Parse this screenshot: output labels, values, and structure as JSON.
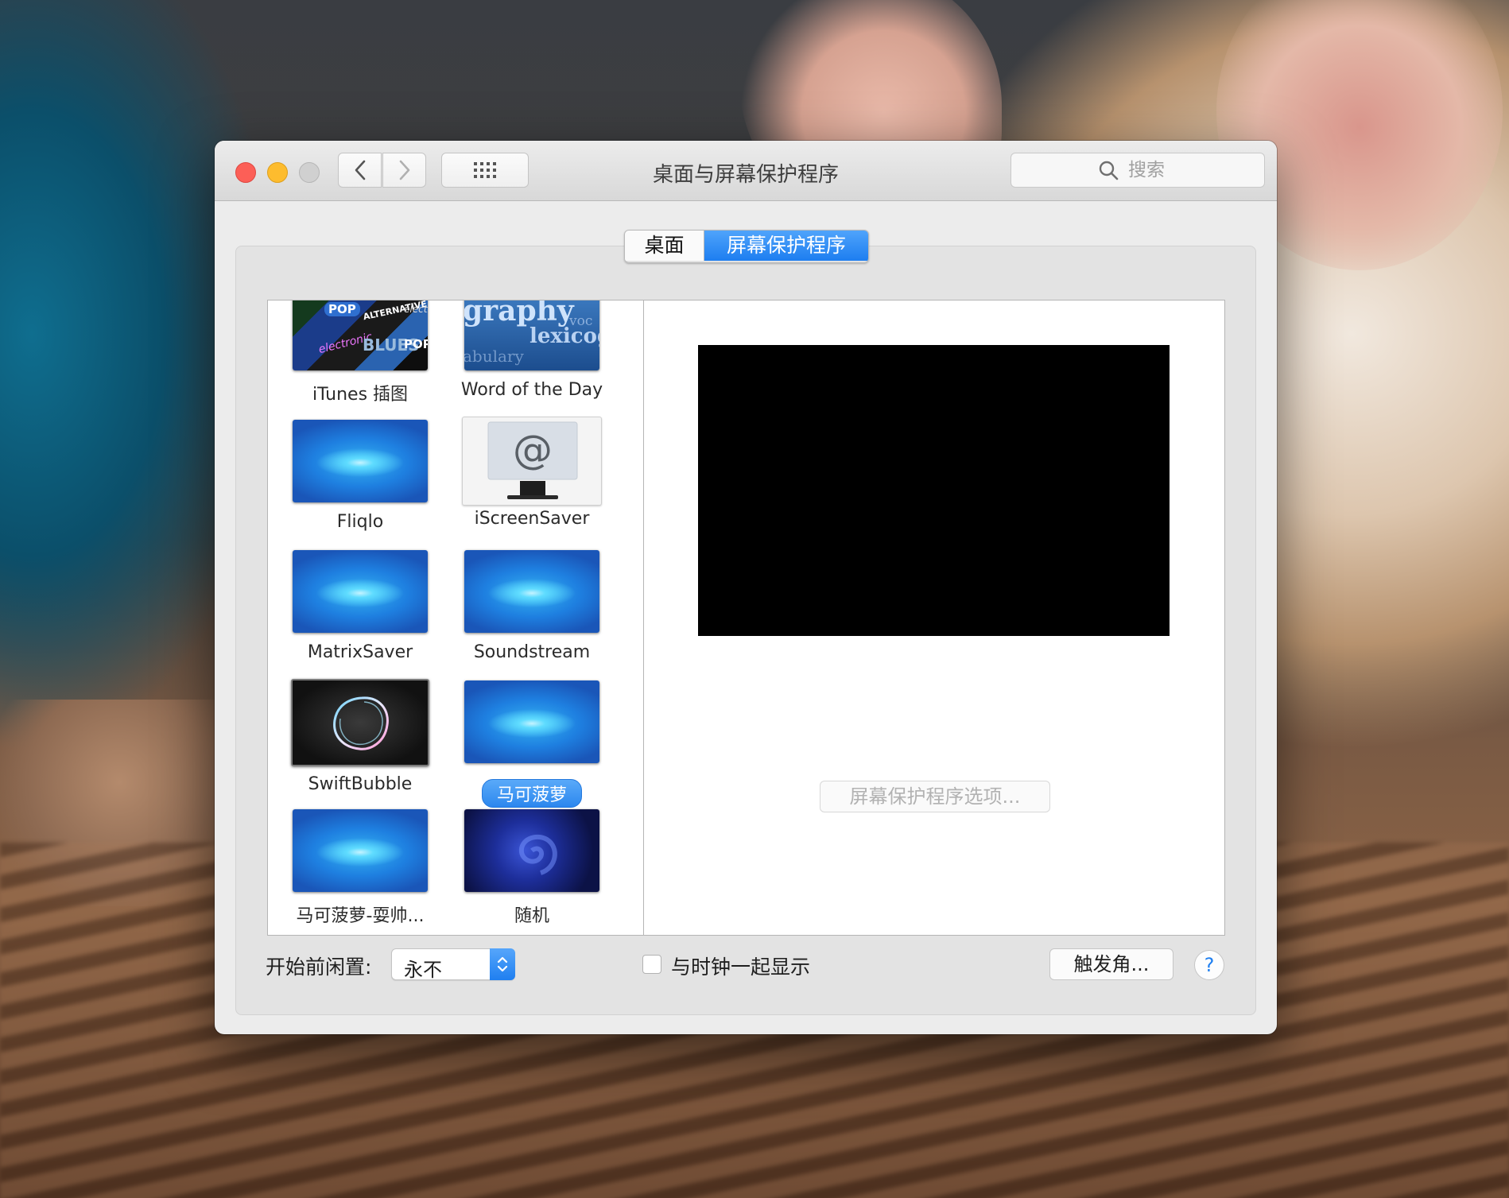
{
  "window": {
    "title": "桌面与屏幕保护程序",
    "search_placeholder": "搜索"
  },
  "tabs": [
    {
      "label": "桌面",
      "selected": false
    },
    {
      "label": "屏幕保护程序",
      "selected": true
    }
  ],
  "screensavers": [
    {
      "label": "iTunes 插图",
      "thumb": "itunes"
    },
    {
      "label": "Word of the Day",
      "thumb": "word"
    },
    {
      "label": "Fliqlo",
      "thumb": "blue"
    },
    {
      "label": "iScreenSaver",
      "thumb": "monitor"
    },
    {
      "label": "MatrixSaver",
      "thumb": "blue"
    },
    {
      "label": "Soundstream",
      "thumb": "blue"
    },
    {
      "label": "SwiftBubble",
      "thumb": "dark"
    },
    {
      "label": "马可菠萝",
      "thumb": "blue",
      "selected": true
    },
    {
      "label": "马可菠萝-耍帅...",
      "thumb": "blue"
    },
    {
      "label": "随机",
      "thumb": "random"
    }
  ],
  "word_thumb_text": [
    "graphy",
    "voc",
    "lexicog",
    "abulary"
  ],
  "itunes_thumb_text": [
    "POP",
    "ALTERNATIVE",
    "electr",
    "electronic",
    "BLUES",
    "POP"
  ],
  "options_button": "屏幕保护程序选项...",
  "idle": {
    "label": "开始前闲置:",
    "value": "永不"
  },
  "show_clock": {
    "label": "与时钟一起显示",
    "checked": false
  },
  "hot_corners_button": "触发角...",
  "help_button": "?",
  "colors": {
    "accent": "#1f7ff0",
    "close": "#fc5f57",
    "minimize": "#fdbc2e"
  }
}
